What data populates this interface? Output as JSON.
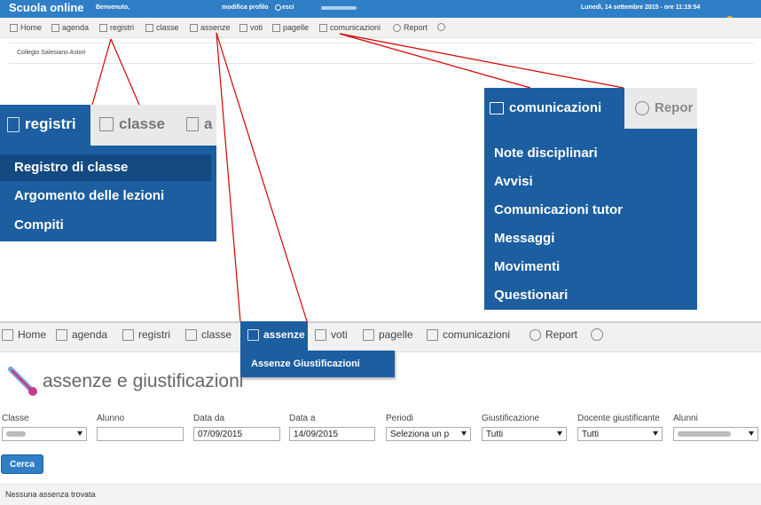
{
  "topbar": {
    "brand": "Scuola online",
    "welcome": "Benvenuto,",
    "modifica_profilo": "modifica profilo",
    "esci": "esci",
    "date": "Lunedì, 14 settembre 2015 - ore 11:19:54",
    "logo": "astori"
  },
  "small_nav": {
    "items": [
      "Home",
      "agenda",
      "registri",
      "classe",
      "assenze",
      "voti",
      "pagelle",
      "comunicazioni",
      "Report"
    ]
  },
  "institute": "Collegio Salesiano Astori",
  "registri_zoom": {
    "tabs": [
      "registri",
      "classe",
      "a"
    ],
    "items": [
      "Registro di classe",
      "Argomento delle lezioni",
      "Compiti"
    ]
  },
  "comunicazioni_zoom": {
    "tabs": [
      "comunicazioni",
      "Repor"
    ],
    "items": [
      "Note disciplinari",
      "Avvisi",
      "Comunicazioni tutor",
      "Messaggi",
      "Movimenti",
      "Questionari"
    ]
  },
  "big_nav": {
    "items": [
      "Home",
      "agenda",
      "registri",
      "classe",
      "assenze",
      "voti",
      "pagelle",
      "comunicazioni",
      "Report"
    ],
    "dropdown_item": "Assenze Giustificazioni"
  },
  "page": {
    "title": "assenze e giustificazioni",
    "filters": {
      "labels": [
        "Classe",
        "Alunno",
        "Data da",
        "Data a",
        "Periodi",
        "Giustificazione",
        "Docente giustificante",
        "Alunni"
      ],
      "data_da": "07/09/2015",
      "data_a": "14/09/2015",
      "periodi": "Seleziona un p",
      "giustificazione": "Tutti",
      "docente": "Tutti"
    },
    "cerca": "Cerca",
    "result": "Nessuna assenza trovata"
  },
  "colors": {
    "accent": "#1c5e9f",
    "topbar": "#2f7fc6",
    "connector": "#d40000"
  }
}
